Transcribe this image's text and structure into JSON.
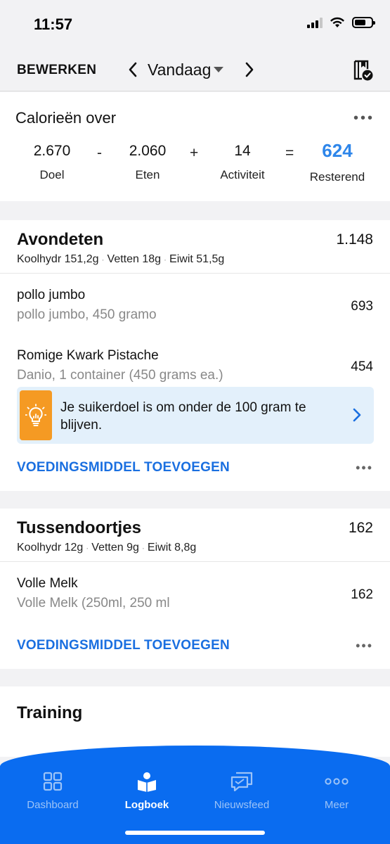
{
  "status": {
    "time": "11:57"
  },
  "nav": {
    "edit_label": "BEWERKEN",
    "date_label": "Vandaag"
  },
  "calories": {
    "title": "Calorieën over",
    "goal": {
      "value": "2.670",
      "label": "Doel"
    },
    "minus": "-",
    "food": {
      "value": "2.060",
      "label": "Eten"
    },
    "plus": "+",
    "activity": {
      "value": "14",
      "label": "Activiteit"
    },
    "equals": "=",
    "remaining": {
      "value": "624",
      "label": "Resterend",
      "color": "#2e86ea"
    }
  },
  "dinner": {
    "name": "Avondeten",
    "total": "1.148",
    "macros": {
      "carbs": "Koolhydr 151,2g",
      "fat": "Vetten 18g",
      "protein": "Eiwit 51,5g",
      "separator": "·"
    },
    "items": [
      {
        "name": "pollo jumbo",
        "desc": "pollo jumbo, 450 gramo",
        "cal": "693"
      },
      {
        "name": "Romige Kwark Pistache",
        "desc": "Danio, 1 container (450 grams ea.)",
        "cal": "454"
      }
    ],
    "tip": {
      "text": "Je suikerdoel is om onder de 100 gram te blijven.",
      "icon": "lightbulb-icon",
      "color": "#f59a23"
    },
    "add_label": "VOEDINGSMIDDEL TOEVOEGEN"
  },
  "snacks": {
    "name": "Tussendoortjes",
    "total": "162",
    "macros": {
      "carbs": "Koolhydr 12g",
      "fat": "Vetten 9g",
      "protein": "Eiwit 8,8g",
      "separator": "·"
    },
    "items": [
      {
        "name": "Volle Melk",
        "desc": "Volle Melk (250ml, 250 ml",
        "cal": "162"
      }
    ],
    "add_label": "VOEDINGSMIDDEL TOEVOEGEN"
  },
  "training": {
    "title": "Training"
  },
  "tabs": [
    {
      "label": "Dashboard",
      "icon": "dashboard-icon",
      "active": false
    },
    {
      "label": "Logboek",
      "icon": "logbook-icon",
      "active": true
    },
    {
      "label": "Nieuwsfeed",
      "icon": "newsfeed-icon",
      "active": false
    },
    {
      "label": "Meer",
      "icon": "more-icon",
      "active": false
    }
  ],
  "colors": {
    "accent": "#0a6cf0",
    "link": "#1a6fe0"
  }
}
